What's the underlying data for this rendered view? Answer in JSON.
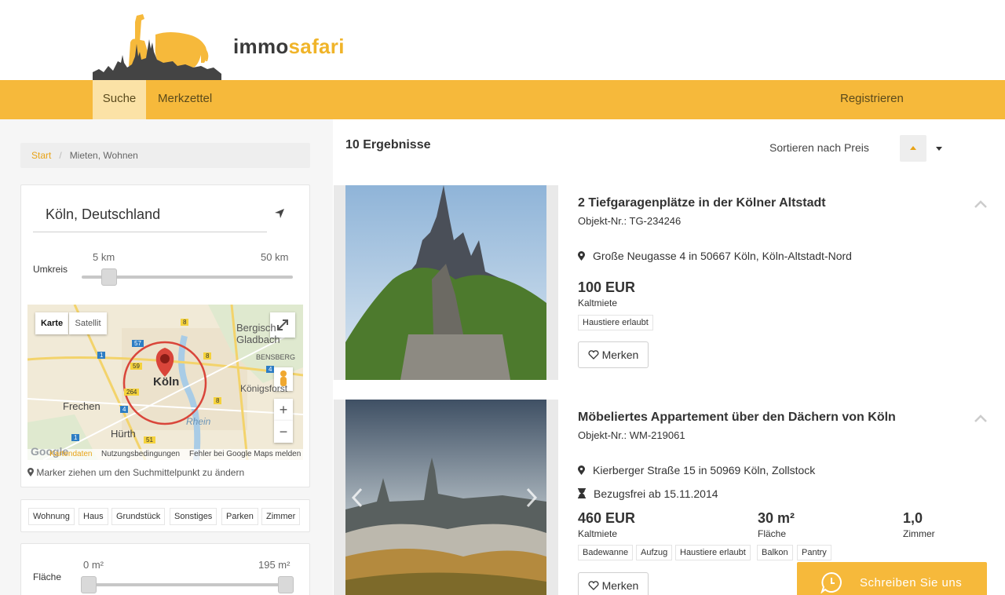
{
  "brand": {
    "part1": "immo",
    "part2": "safari"
  },
  "nav": {
    "items": [
      {
        "label": "Suche"
      },
      {
        "label": "Merkzettel"
      }
    ],
    "register": "Registrieren"
  },
  "breadcrumb": {
    "start": "Start",
    "separator": "/",
    "current": "Mieten, Wohnen"
  },
  "search": {
    "location_value": "Köln, Deutschland",
    "radius_label": "Umkreis",
    "radius_min": "5 km",
    "radius_max": "50 km",
    "radius_fraction": 0.1
  },
  "map": {
    "type_map": "Karte",
    "type_satellite": "Satellit",
    "city": "Köln",
    "labels": [
      "Bergisch Gladbach",
      "BENSBERG",
      "Königsforst",
      "Frechen",
      "Hürth",
      "Rhein"
    ],
    "road_numbers": [
      "57",
      "1",
      "59",
      "264",
      "4",
      "8",
      "51",
      "1",
      "8",
      "4",
      "8"
    ],
    "footer_logo": "Google",
    "footer_data": "Kartendaten",
    "footer_terms": "Nutzungsbedingungen",
    "footer_report": "Fehler bei Google Maps melden",
    "zoom_in": "+",
    "zoom_out": "−"
  },
  "map_note": "Marker ziehen um den Suchmittelpunkt zu ändern",
  "property_types": [
    "Wohnung",
    "Haus",
    "Grundstück",
    "Sonstiges",
    "Parken",
    "Zimmer"
  ],
  "area": {
    "label": "Fläche",
    "min": "0 m²",
    "max": "195 m²"
  },
  "results": {
    "count_text": "10 Ergebnisse",
    "sort_label": "Sortieren nach Preis"
  },
  "listings": [
    {
      "title": "2 Tiefgaragenplätze in der Kölner Altstadt",
      "object_no": "Objekt-Nr.: TG-234246",
      "address": "Große Neugasse 4 in 50667 Köln, Köln-Altstadt-Nord",
      "price": "100 EUR",
      "price_label": "Kaltmiete",
      "features": [
        "Haustiere erlaubt"
      ],
      "merken": "Merken"
    },
    {
      "title": "Möbeliertes Appartement über den Dächern von Köln",
      "object_no": "Objekt-Nr.: WM-219061",
      "address": "Kierberger Straße 15 in 50969 Köln, Zollstock",
      "availability": "Bezugsfrei ab 15.11.2014",
      "price": "460 EUR",
      "price_label": "Kaltmiete",
      "area": "30 m²",
      "area_label": "Fläche",
      "rooms": "1,0",
      "rooms_label": "Zimmer",
      "features": [
        "Badewanne",
        "Aufzug",
        "Haustiere erlaubt",
        "Balkon",
        "Pantry"
      ],
      "merken": "Merken"
    }
  ],
  "chat": {
    "label": "Schreiben Sie uns"
  },
  "colors": {
    "accent": "#f6b93b",
    "accent_light": "#fbe2a6",
    "link": "#e8a317",
    "marker": "#d9453a"
  }
}
